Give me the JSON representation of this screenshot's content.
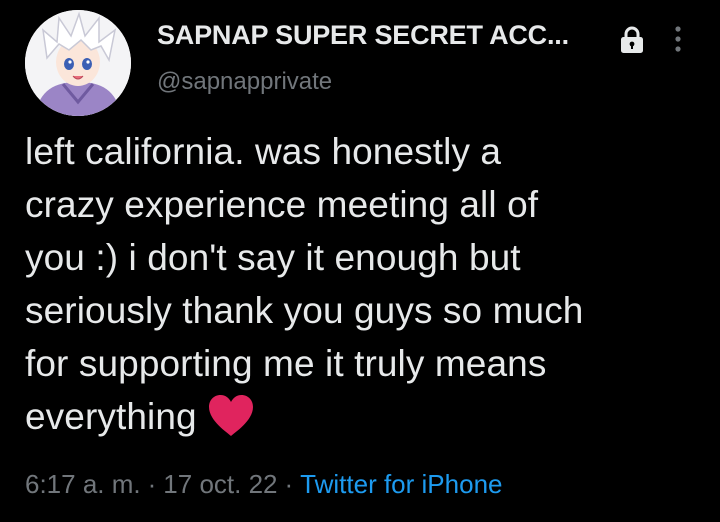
{
  "user": {
    "display_name": "SAPNAP SUPER SECRET ACC...",
    "handle": "@sapnapprivate",
    "protected_icon": "lock-icon",
    "more_icon": "more-vertical-icon"
  },
  "tweet": {
    "lines": [
      "left california. was honestly a",
      "crazy experience meeting all of",
      "you :) i don't say it enough but",
      "seriously thank you guys so much",
      "for supporting me it truly means",
      "everything"
    ],
    "emoji_icon": "red-heart-icon"
  },
  "meta": {
    "time": "6:17 a. m.",
    "separator": "·",
    "date": "17 oct. 22",
    "source": "Twitter for iPhone"
  },
  "colors": {
    "background": "#000000",
    "text_primary": "#e7e9ea",
    "text_secondary": "#71767b",
    "link": "#1d9bf0",
    "heart": "#e0245e"
  }
}
